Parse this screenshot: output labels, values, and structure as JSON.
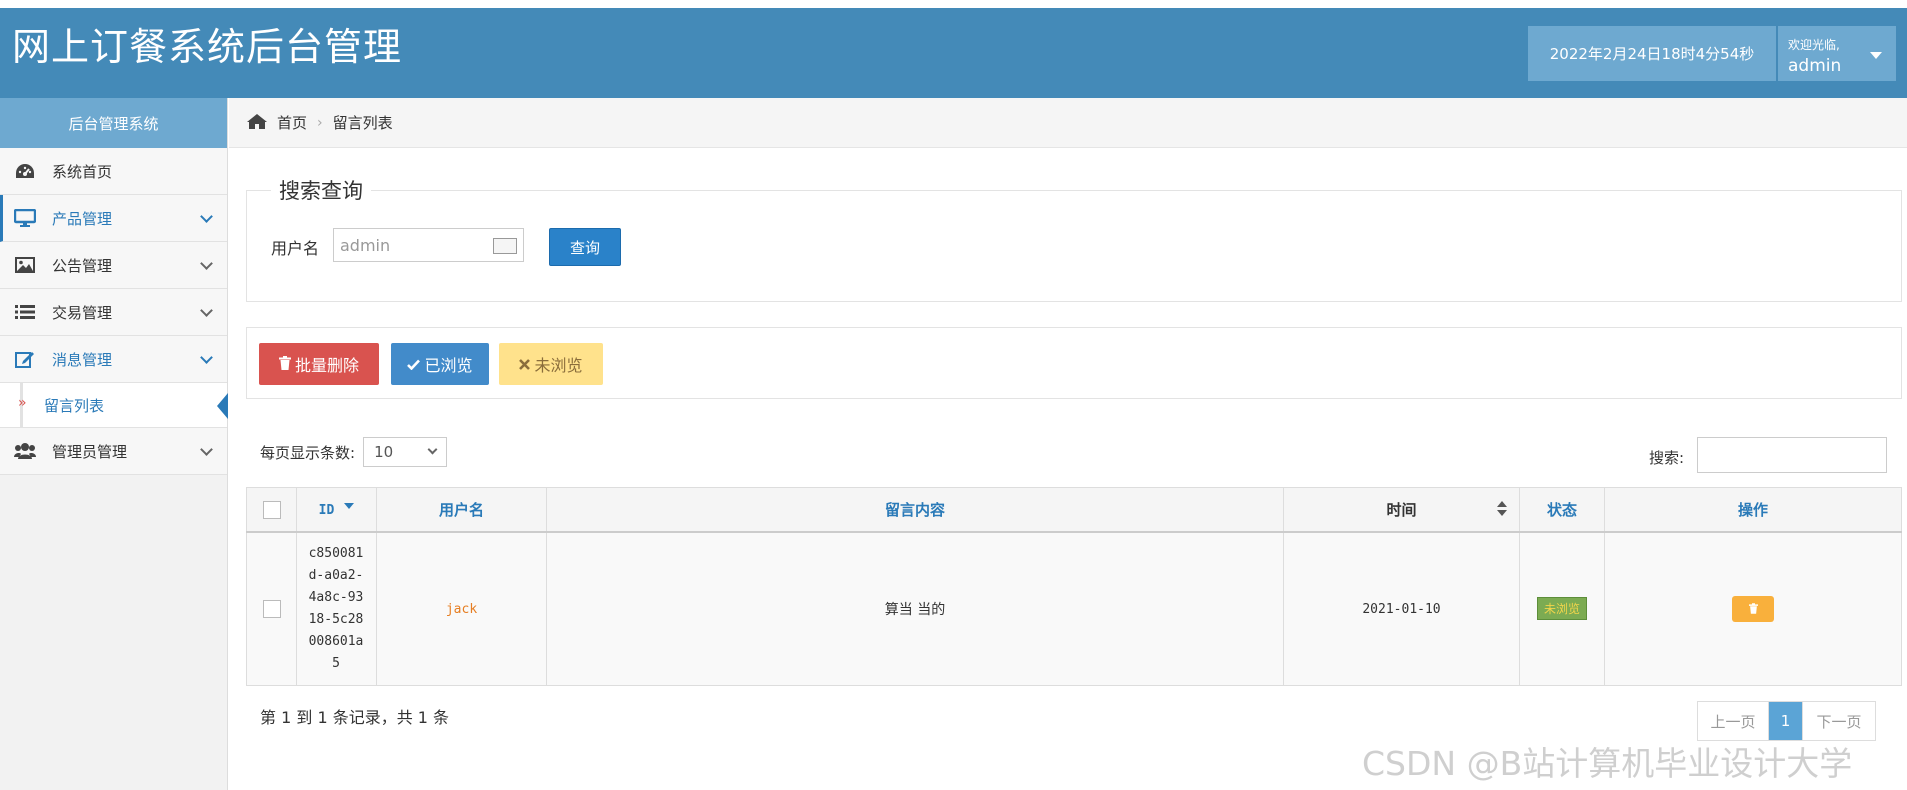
{
  "header": {
    "app_title": "网上订餐系统后台管理",
    "datetime": "2022年2月24日18时4分54秒",
    "welcome": "欢迎光临,",
    "username": "admin"
  },
  "sidebar": {
    "title": "后台管理系统",
    "items": [
      {
        "label": "系统首页",
        "icon": "dashboard-icon"
      },
      {
        "label": "产品管理",
        "icon": "monitor-icon"
      },
      {
        "label": "公告管理",
        "icon": "image-icon"
      },
      {
        "label": "交易管理",
        "icon": "list-icon"
      },
      {
        "label": "消息管理",
        "icon": "edit-icon"
      },
      {
        "label": "管理员管理",
        "icon": "users-icon"
      }
    ],
    "sub_item": "留言列表"
  },
  "breadcrumb": {
    "home": "首页",
    "current": "留言列表"
  },
  "search": {
    "legend": "搜索查询",
    "username_label": "用户名",
    "username_placeholder": "admin",
    "query_button": "查询"
  },
  "toolbar": {
    "batch_delete": "批量删除",
    "mark_read": "已浏览",
    "mark_unread": "未浏览"
  },
  "table_controls": {
    "page_size_label": "每页显示条数:",
    "page_size_value": "10",
    "search_label": "搜索:"
  },
  "table": {
    "columns": [
      "ID",
      "用户名",
      "留言内容",
      "时间",
      "状态",
      "操作"
    ],
    "rows": [
      {
        "id": "c850081d-a0a2-4a8c-9318-5c28008601a5",
        "username": "jack",
        "content": "算当 当的",
        "time": "2021-01-10",
        "status": "未浏览"
      }
    ]
  },
  "pagination": {
    "info": "第 1 到 1 条记录，共 1 条",
    "prev": "上一页",
    "current": "1",
    "next": "下一页"
  },
  "watermark": "CSDN @B站计算机毕业设计大学",
  "colors": {
    "header_bg": "#448ab8",
    "accent": "#2a7ab8",
    "danger": "#d9534f",
    "warning": "#ffe28c",
    "status_green": "#7cab52",
    "trash_orange": "#f9b03c"
  }
}
